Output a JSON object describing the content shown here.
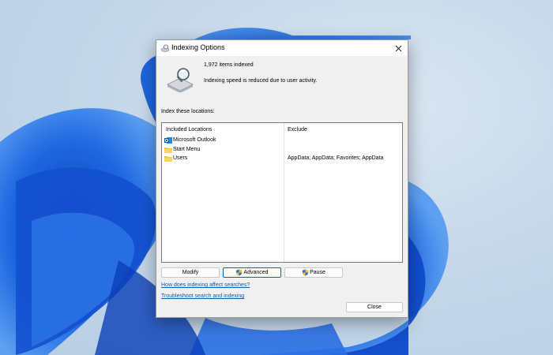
{
  "dialog": {
    "title": "Indexing Options",
    "items_indexed": "1,972 items indexed",
    "status_message": "Indexing speed is reduced due to user activity.",
    "locations_label": "Index these locations:",
    "columns": {
      "included": "Included Locations",
      "exclude": "Exclude"
    },
    "locations": [
      {
        "name": "Microsoft Outlook",
        "icon": "outlook-icon",
        "exclude": ""
      },
      {
        "name": "Start Menu",
        "icon": "folder-icon",
        "exclude": ""
      },
      {
        "name": "Users",
        "icon": "folder-icon",
        "exclude": "AppData; AppData; Favorites; AppData"
      }
    ],
    "buttons": {
      "modify": "Modify",
      "advanced": "Advanced",
      "pause": "Pause",
      "close": "Close"
    },
    "links": {
      "how_indexing": "How does indexing affect searches?",
      "troubleshoot": "Troubleshoot search and indexing"
    }
  },
  "colors": {
    "accent": "#0067c0",
    "link": "#0b5cad",
    "wallpaper_blue": "#1a5fd6"
  }
}
